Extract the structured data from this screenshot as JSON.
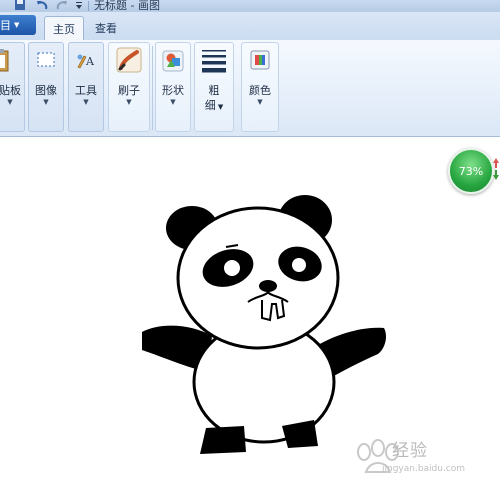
{
  "window": {
    "title": "无标题 - 画图"
  },
  "app_menu": {
    "label": "目"
  },
  "tabs": [
    {
      "label": "主页",
      "active": true
    },
    {
      "label": "查看",
      "active": false
    }
  ],
  "ribbon": {
    "clipboard": {
      "label": "贴板",
      "icon": "clipboard-icon"
    },
    "image": {
      "label": "图像",
      "icon": "select-rect-icon"
    },
    "tools": {
      "label": "工具",
      "icon": "pencil-text-icon"
    },
    "brushes": {
      "label": "刷子",
      "icon": "brush-icon"
    },
    "shapes": {
      "label": "形状",
      "icon": "shapes-icon"
    },
    "size": {
      "label_top": "粗",
      "label_bottom": "细",
      "icon": "line-size-icon"
    },
    "colors": {
      "label": "颜色",
      "icon": "palette-icon"
    }
  },
  "status_widget": {
    "percent": "73%",
    "accent": "#27a640"
  },
  "watermark": {
    "text": "经验",
    "url": "jingyan.baidu.com"
  }
}
